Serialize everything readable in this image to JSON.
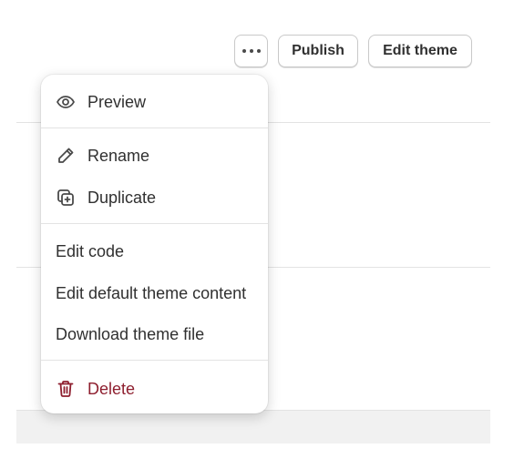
{
  "header": {
    "more_actions_icon": "horizontal-dots-icon",
    "publish_label": "Publish",
    "edit_theme_label": "Edit theme"
  },
  "menu": {
    "sections": [
      {
        "items": [
          {
            "label": "Preview",
            "icon": "eye-icon"
          }
        ]
      },
      {
        "items": [
          {
            "label": "Rename",
            "icon": "pencil-icon"
          },
          {
            "label": "Duplicate",
            "icon": "duplicate-icon"
          }
        ]
      },
      {
        "items": [
          {
            "label": "Edit code"
          },
          {
            "label": "Edit default theme content"
          },
          {
            "label": "Download theme file"
          }
        ]
      },
      {
        "items": [
          {
            "label": "Delete",
            "icon": "trash-icon",
            "tone": "critical"
          }
        ]
      }
    ]
  },
  "colors": {
    "text": "#303030",
    "critical": "#8e1f2f",
    "divider": "#e3e3e3"
  }
}
